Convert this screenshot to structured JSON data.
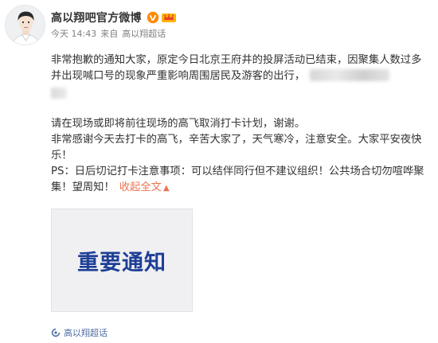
{
  "user": {
    "name": "高以翔吧官方微博",
    "verified_icon": "verified-v-icon",
    "member_icon": "vip-crown-icon"
  },
  "meta": {
    "time": "今天 14:43",
    "source_prefix": "来自",
    "source": "高以翔超话"
  },
  "content": {
    "line1": "非常抱歉的通知大家，原定今日北京王府井的投屏活动已结束，因聚集人数过多并出现喊口号的现象严重影响周围居民及游客的出行，",
    "line2": "请在现场或即将前往现场的高飞取消打卡计划，谢谢。",
    "line3": "非常感谢今天去打卡的高飞，辛苦大家了，天气寒冷，注意安全。大家平安夜快乐！",
    "line4": "PS：日后切记打卡注意事项：可以结伴同行但不建议组织！公共场合切勿喧哗聚集！望周知！",
    "collapse_label": "收起全文",
    "collapse_arrow_icon": "chevron-up-icon"
  },
  "image": {
    "title": "重要通知"
  },
  "footer": {
    "topic_icon": "super-topic-icon",
    "topic": "高以翔超话"
  },
  "colors": {
    "link": "#eb7350",
    "topic": "#4e6ea2",
    "notice_text": "#1f3f96",
    "verified": "#ff8a00"
  }
}
